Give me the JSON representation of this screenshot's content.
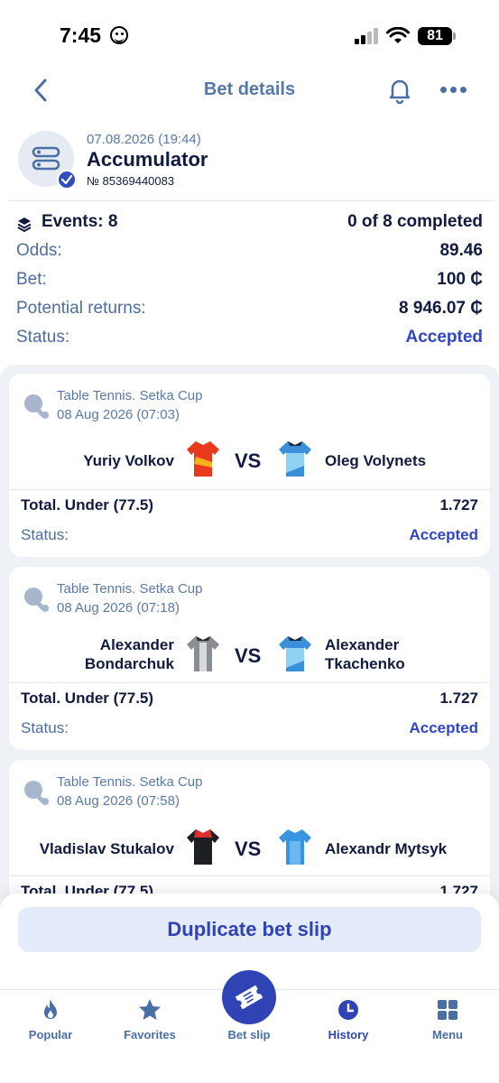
{
  "status_bar": {
    "time": "7:45",
    "battery": "81"
  },
  "nav": {
    "title": "Bet details"
  },
  "bet": {
    "date": "07.08.2026 (19:44)",
    "type": "Accumulator",
    "number": "№ 85369440083",
    "events_label": "Events: 8",
    "completed": "0 of 8 completed",
    "odds_label": "Odds:",
    "odds_value": "89.46",
    "bet_label": "Bet:",
    "bet_value": "100 ₵",
    "returns_label": "Potential returns:",
    "returns_value": "8 946.07 ₵",
    "status_label": "Status:",
    "status_value": "Accepted"
  },
  "events": [
    {
      "league": "Table Tennis. Setka Cup",
      "datetime": "08 Aug 2026 (07:03)",
      "team1": "Yuriy Volkov",
      "team2": "Oleg Volynets",
      "vs": "VS",
      "market": "Total. Under (77.5)",
      "odd": "1.727",
      "status_label": "Status:",
      "status": "Accepted"
    },
    {
      "league": "Table Tennis. Setka Cup",
      "datetime": "08 Aug 2026 (07:18)",
      "team1_line1": "Alexander",
      "team1_line2": "Bondarchuk",
      "team2_line1": "Alexander",
      "team2_line2": "Tkachenko",
      "vs": "VS",
      "market": "Total. Under (77.5)",
      "odd": "1.727",
      "status_label": "Status:",
      "status": "Accepted"
    },
    {
      "league": "Table Tennis. Setka Cup",
      "datetime": "08 Aug 2026 (07:58)",
      "team1": "Vladislav Stukalov",
      "team2": "Alexandr Mytsyk",
      "vs": "VS",
      "market": "Total. Under (77.5)",
      "odd": "1.727"
    }
  ],
  "actions": {
    "duplicate": "Duplicate bet slip"
  },
  "tabbar": {
    "popular": "Popular",
    "favorites": "Favorites",
    "bet_slip": "Bet slip",
    "history": "History",
    "menu": "Menu"
  },
  "colors": {
    "accent": "#2f43b5",
    "muted": "#4e6d9b",
    "text": "#111a3f",
    "panel": "#eef1f6"
  }
}
